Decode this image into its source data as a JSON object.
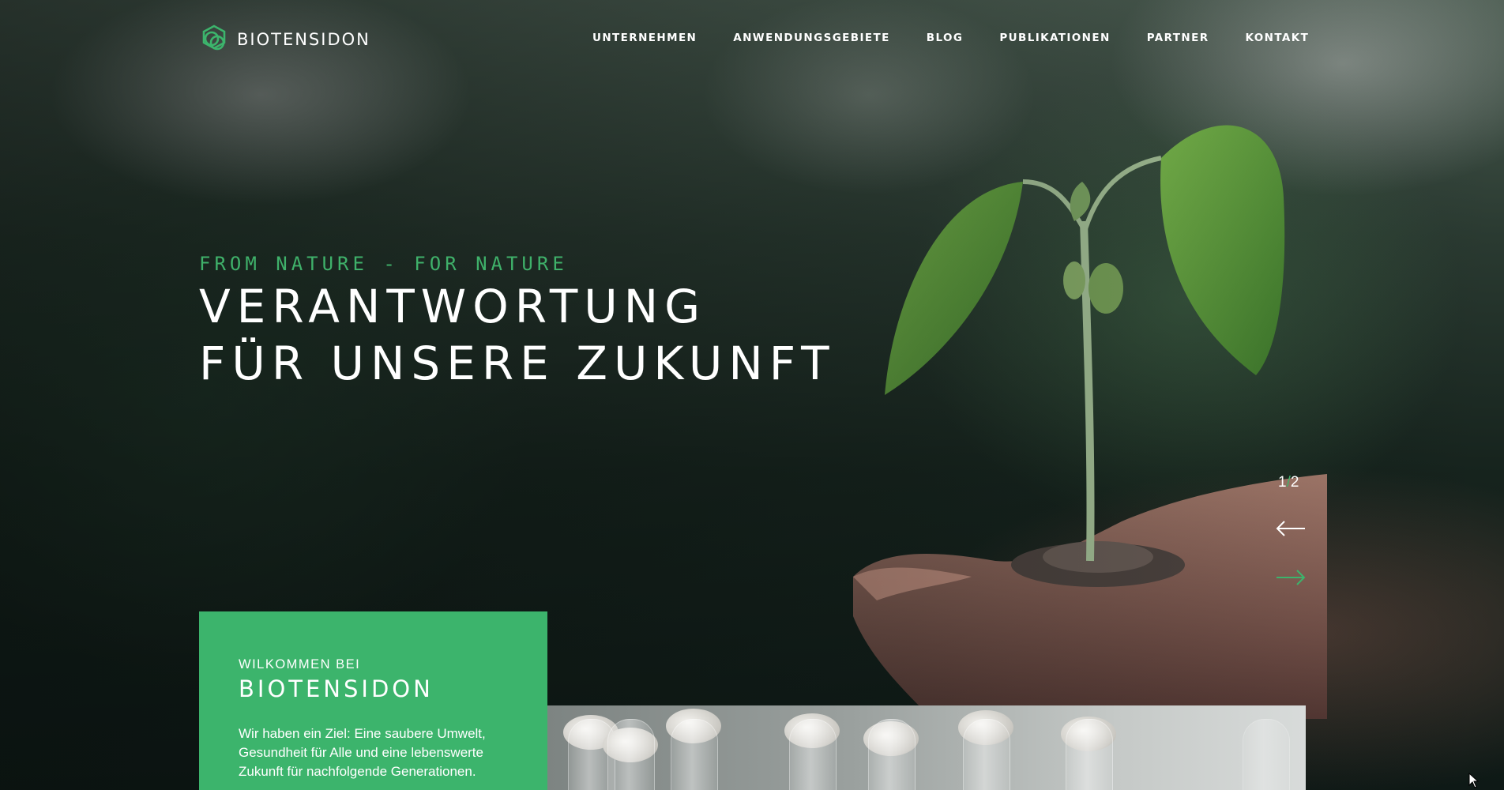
{
  "brand": {
    "name": "BIOTENSIDON",
    "accent": "#3cb46c"
  },
  "nav": {
    "items": [
      {
        "label": "UNTERNEHMEN"
      },
      {
        "label": "ANWENDUNGSGEBIETE"
      },
      {
        "label": "BLOG"
      },
      {
        "label": "PUBLIKATIONEN"
      },
      {
        "label": "PARTNER"
      },
      {
        "label": "KONTAKT"
      }
    ]
  },
  "hero": {
    "kicker": "FROM NATURE - FOR NATURE",
    "headline_line1": "VERANTWORTUNG",
    "headline_line2": "FÜR UNSERE ZUKUNFT",
    "slide_current": "1",
    "slide_separator": "/",
    "slide_total": "2",
    "prev_icon": "arrow-left-icon",
    "next_icon": "arrow-right-icon"
  },
  "welcome": {
    "small": "WILKOMMEN BEI",
    "big": "BIOTENSIDON",
    "text": "Wir haben ein Ziel: Eine saubere Umwelt, Gesundheit für Alle und eine lebenswerte Zukunft für nachfolgende Generationen."
  }
}
